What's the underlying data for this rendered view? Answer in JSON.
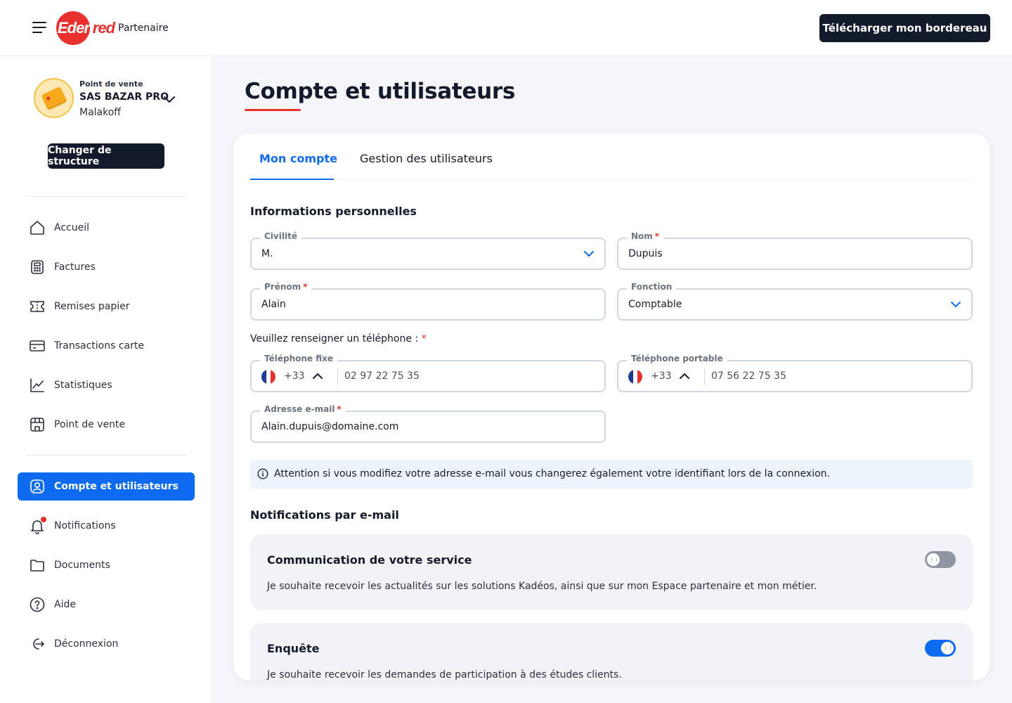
{
  "header": {
    "logo_prefix": "Eden",
    "logo_suffix": "red",
    "logo_sub": "Partenaire",
    "download_label": "Télécharger mon bordereau"
  },
  "point_de_vente": {
    "caption": "Point de vente",
    "name": "SAS BAZAR PRO",
    "city": "Malakoff",
    "change_label": "Changer de structure"
  },
  "sidebar": {
    "items": [
      {
        "label": "Accueil",
        "icon": "home-icon"
      },
      {
        "label": "Factures",
        "icon": "invoice-icon"
      },
      {
        "label": "Remises papier",
        "icon": "ticket-icon"
      },
      {
        "label": "Transactions carte",
        "icon": "card-icon"
      },
      {
        "label": "Statistiques",
        "icon": "chart-icon"
      },
      {
        "label": "Point de vente",
        "icon": "store-icon"
      },
      {
        "label": "Compte et utilisateurs",
        "icon": "user-icon",
        "active": true
      },
      {
        "label": "Notifications",
        "icon": "bell-icon"
      },
      {
        "label": "Documents",
        "icon": "folder-icon"
      },
      {
        "label": "Aide",
        "icon": "help-icon"
      },
      {
        "label": "Déconnexion",
        "icon": "logout-icon"
      }
    ]
  },
  "page": {
    "title": "Compte et utilisateurs",
    "tabs": [
      {
        "label": "Mon compte",
        "active": true
      },
      {
        "label": "Gestion des utilisateurs",
        "active": false
      }
    ]
  },
  "personal": {
    "title": "Informations personnelles",
    "civilite": {
      "label": "Civilité",
      "value": "M."
    },
    "nom": {
      "label": "Nom",
      "value": "Dupuis"
    },
    "prenom": {
      "label": "Prénom",
      "value": "Alain"
    },
    "fonction": {
      "label": "Fonction",
      "value": "Comptable"
    },
    "phone_prompt": "Veuillez renseigner un téléphone :",
    "tel_fixe": {
      "label": "Téléphone fixe",
      "code": "+33",
      "value": "02 97 22 75 35"
    },
    "tel_portable": {
      "label": "Téléphone portable",
      "code": "+33",
      "value": "07 56 22 75 35"
    },
    "email": {
      "label": "Adresse e-mail",
      "value": "Alain.dupuis@domaine.com"
    },
    "required_mark": "*",
    "email_warning": "Attention si vous modifiez votre adresse e-mail vous changerez également votre identifiant lors de la connexion."
  },
  "notifications": {
    "title": "Notifications par e-mail",
    "items": [
      {
        "title": "Communication de votre service",
        "description": "Je souhaite recevoir les actualités sur les solutions Kadéos, ainsi que sur mon Espace partenaire et mon métier.",
        "enabled": false
      },
      {
        "title": "Enquête",
        "description": "Je souhaite recevoir les demandes de participation à des études clients.",
        "enabled": true
      }
    ]
  },
  "colors": {
    "brand_red": "#e8312f",
    "primary_blue": "#0d6bf0",
    "dark_button": "#131a2b"
  }
}
